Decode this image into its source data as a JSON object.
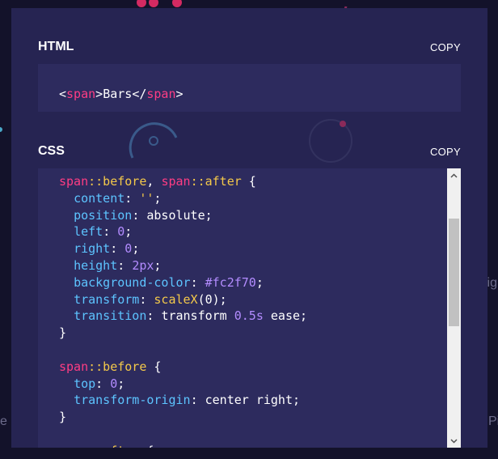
{
  "background": {
    "side_text_right_top": "Hig",
    "side_text_right_bottom": "Pi",
    "side_text_left_bottom": "e"
  },
  "html_section": {
    "title": "HTML",
    "copy_label": "COPY",
    "code": {
      "open_lt": "<",
      "open_tag": "span",
      "open_gt": ">",
      "text": "Bars",
      "close_lt": "</",
      "close_tag": "span",
      "close_gt": ">"
    }
  },
  "css_section": {
    "title": "CSS",
    "copy_label": "COPY",
    "lines": [
      [
        {
          "t": "sel",
          "v": "span"
        },
        {
          "t": "pseudo",
          "v": "::before"
        },
        {
          "t": "punc",
          "v": ", "
        },
        {
          "t": "sel",
          "v": "span"
        },
        {
          "t": "pseudo",
          "v": "::after"
        },
        {
          "t": "punc",
          "v": " {"
        }
      ],
      [
        {
          "t": "punc",
          "v": "  "
        },
        {
          "t": "prop",
          "v": "content"
        },
        {
          "t": "punc",
          "v": ": "
        },
        {
          "t": "str",
          "v": "''"
        },
        {
          "t": "punc",
          "v": ";"
        }
      ],
      [
        {
          "t": "punc",
          "v": "  "
        },
        {
          "t": "prop",
          "v": "position"
        },
        {
          "t": "punc",
          "v": ": "
        },
        {
          "t": "val",
          "v": "absolute"
        },
        {
          "t": "punc",
          "v": ";"
        }
      ],
      [
        {
          "t": "punc",
          "v": "  "
        },
        {
          "t": "prop",
          "v": "left"
        },
        {
          "t": "punc",
          "v": ": "
        },
        {
          "t": "num",
          "v": "0"
        },
        {
          "t": "punc",
          "v": ";"
        }
      ],
      [
        {
          "t": "punc",
          "v": "  "
        },
        {
          "t": "prop",
          "v": "right"
        },
        {
          "t": "punc",
          "v": ": "
        },
        {
          "t": "num",
          "v": "0"
        },
        {
          "t": "punc",
          "v": ";"
        }
      ],
      [
        {
          "t": "punc",
          "v": "  "
        },
        {
          "t": "prop",
          "v": "height"
        },
        {
          "t": "punc",
          "v": ": "
        },
        {
          "t": "num",
          "v": "2px"
        },
        {
          "t": "punc",
          "v": ";"
        }
      ],
      [
        {
          "t": "punc",
          "v": "  "
        },
        {
          "t": "prop",
          "v": "background-color"
        },
        {
          "t": "punc",
          "v": ": "
        },
        {
          "t": "num",
          "v": "#fc2f70"
        },
        {
          "t": "punc",
          "v": ";"
        }
      ],
      [
        {
          "t": "punc",
          "v": "  "
        },
        {
          "t": "prop",
          "v": "transform"
        },
        {
          "t": "punc",
          "v": ": "
        },
        {
          "t": "fn",
          "v": "scaleX"
        },
        {
          "t": "punc",
          "v": "("
        },
        {
          "t": "val",
          "v": "0"
        },
        {
          "t": "punc",
          "v": ");"
        }
      ],
      [
        {
          "t": "punc",
          "v": "  "
        },
        {
          "t": "prop",
          "v": "transition"
        },
        {
          "t": "punc",
          "v": ": "
        },
        {
          "t": "val",
          "v": "transform "
        },
        {
          "t": "num",
          "v": "0.5s"
        },
        {
          "t": "val",
          "v": " ease"
        },
        {
          "t": "punc",
          "v": ";"
        }
      ],
      [
        {
          "t": "punc",
          "v": "}"
        }
      ],
      [
        {
          "t": "punc",
          "v": " "
        }
      ],
      [
        {
          "t": "sel",
          "v": "span"
        },
        {
          "t": "pseudo",
          "v": "::before"
        },
        {
          "t": "punc",
          "v": " {"
        }
      ],
      [
        {
          "t": "punc",
          "v": "  "
        },
        {
          "t": "prop",
          "v": "top"
        },
        {
          "t": "punc",
          "v": ": "
        },
        {
          "t": "num",
          "v": "0"
        },
        {
          "t": "punc",
          "v": ";"
        }
      ],
      [
        {
          "t": "punc",
          "v": "  "
        },
        {
          "t": "prop",
          "v": "transform-origin"
        },
        {
          "t": "punc",
          "v": ": "
        },
        {
          "t": "val",
          "v": "center right"
        },
        {
          "t": "punc",
          "v": ";"
        }
      ],
      [
        {
          "t": "punc",
          "v": "}"
        }
      ],
      [
        {
          "t": "punc",
          "v": " "
        }
      ],
      [
        {
          "t": "sel",
          "v": "span"
        },
        {
          "t": "pseudo",
          "v": "::after"
        },
        {
          "t": "punc",
          "v": " {"
        }
      ]
    ]
  },
  "colors": {
    "page_bg": "#13122a",
    "panel_bg": "#262452",
    "code_bg": "#2d2b5e",
    "selector": "#ff3d84",
    "pseudo": "#f4c94a",
    "property": "#5dc4ff",
    "number": "#b38cff"
  }
}
